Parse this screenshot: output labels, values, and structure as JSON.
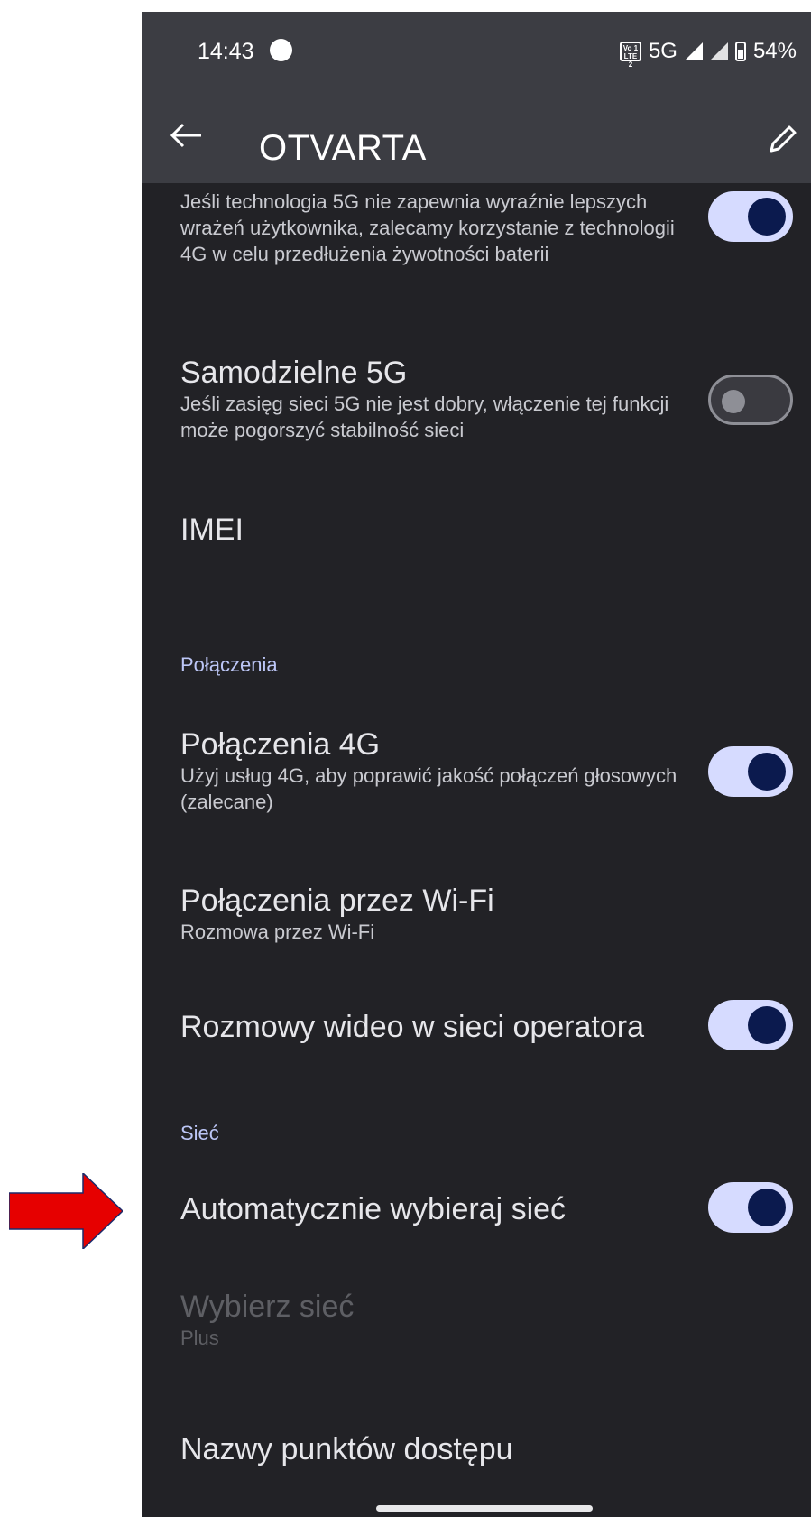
{
  "status_bar": {
    "time": "14:43",
    "volte_badge": "Vo 1 LTE 2",
    "network": "5G",
    "battery": "54%"
  },
  "app_bar": {
    "title": "OTVARTA",
    "back_icon": "arrow-left-icon",
    "edit_icon": "pencil-icon"
  },
  "settings": {
    "top_item": {
      "subtitle": "Jeśli technologia 5G nie zapewnia wyraźnie lepszych wrażeń użytkownika, zalecamy korzystanie z technologii 4G w celu przedłużenia żywotności baterii",
      "toggle_on": true
    },
    "standalone_5g": {
      "title": "Samodzielne 5G",
      "subtitle": "Jeśli zasięg sieci 5G nie jest dobry, włączenie tej funkcji może pogorszyć stabilność sieci",
      "toggle_on": false
    },
    "imei": {
      "title": "IMEI"
    },
    "section_calls": "Połączenia",
    "calls_4g": {
      "title": "Połączenia 4G",
      "subtitle": "Użyj usług 4G, aby poprawić jakość połączeń głosowych (zalecane)",
      "toggle_on": true
    },
    "wifi_calls": {
      "title": "Połączenia przez Wi-Fi",
      "subtitle": "Rozmowa przez Wi-Fi"
    },
    "video_calls": {
      "title": "Rozmowy wideo w sieci operatora",
      "toggle_on": true
    },
    "section_network": "Sieć",
    "auto_network": {
      "title": "Automatycznie wybieraj sieć",
      "toggle_on": true
    },
    "choose_network": {
      "title": "Wybierz sieć",
      "subtitle": "Plus",
      "disabled": true
    },
    "apn": {
      "title": "Nazwy punktów dostępu"
    }
  },
  "annotation": {
    "arrow_color": "#e60000"
  }
}
